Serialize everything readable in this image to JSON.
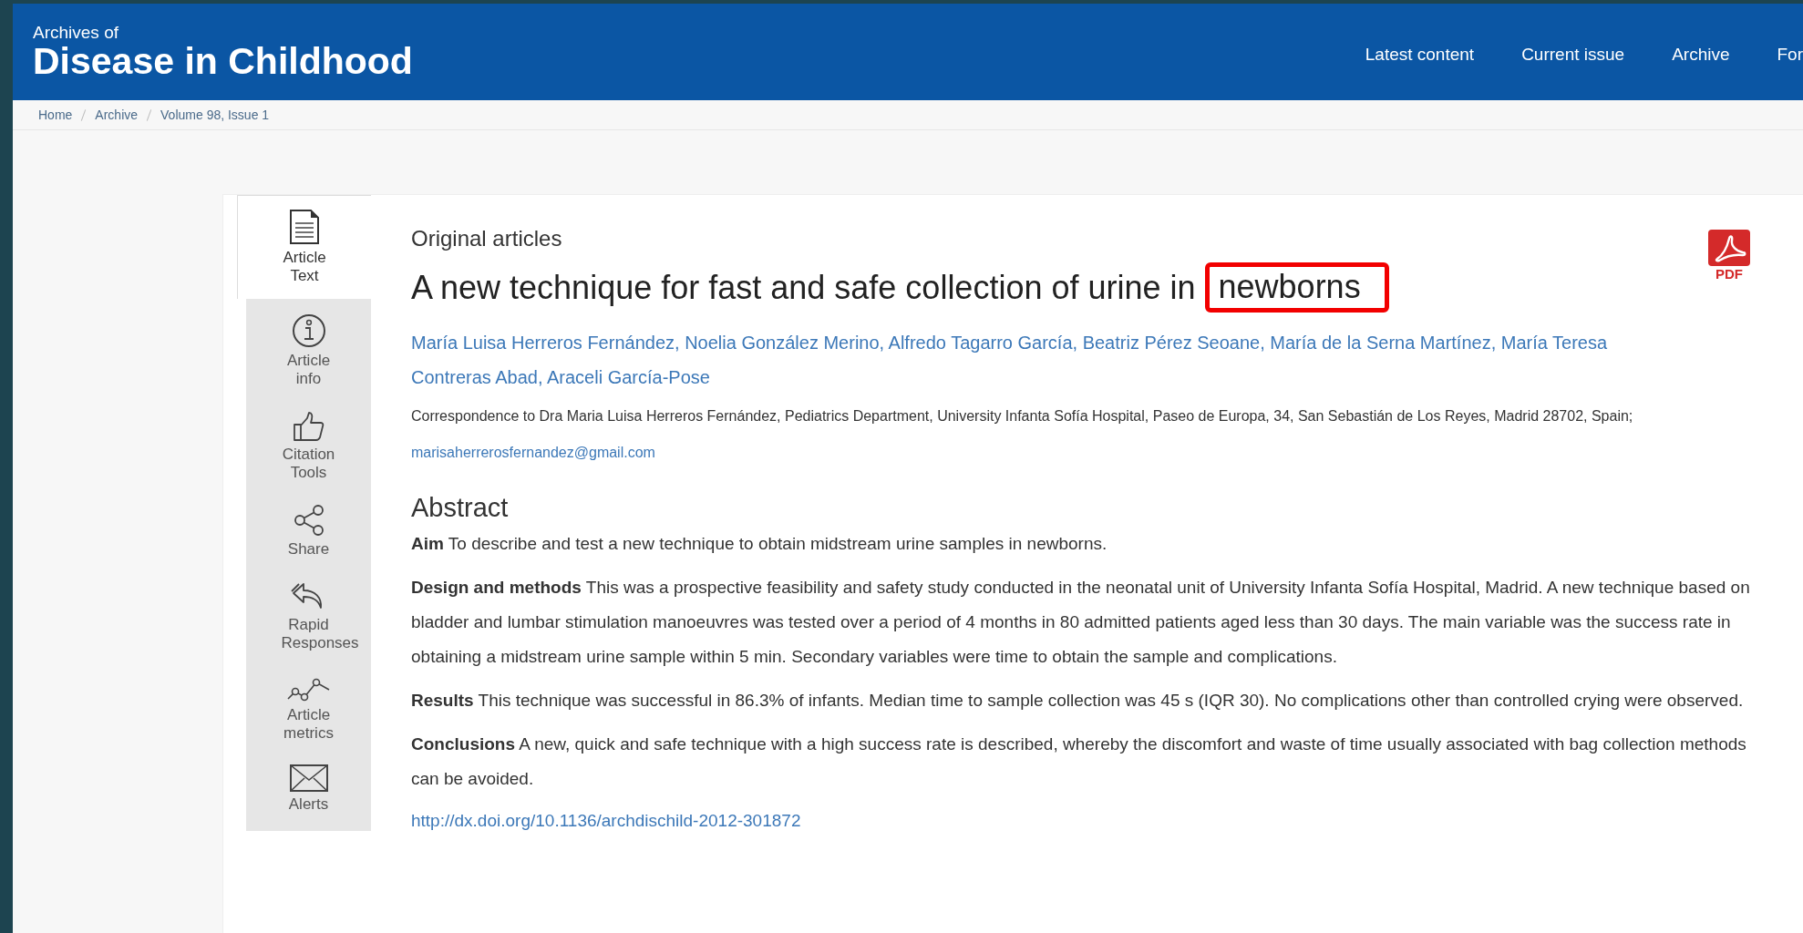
{
  "journal": {
    "prefix": "Archives of",
    "name": "Disease in Childhood"
  },
  "nav": [
    "Latest content",
    "Current issue",
    "Archive",
    "For"
  ],
  "breadcrumb": [
    "Home",
    "Archive",
    "Volume 98, Issue 1"
  ],
  "tabs": [
    {
      "label": "Article Text",
      "kind": "document",
      "selected": true
    },
    {
      "label": "Article info",
      "kind": "info",
      "selected": false
    },
    {
      "label": "Citation Tools",
      "kind": "thumb",
      "selected": false
    },
    {
      "label": "Share",
      "kind": "share",
      "selected": false
    },
    {
      "label": "Rapid Responses",
      "kind": "reply",
      "selected": false
    },
    {
      "label": "Article metrics",
      "kind": "metrics",
      "selected": false
    },
    {
      "label": "Alerts",
      "kind": "mail",
      "selected": false
    }
  ],
  "article": {
    "section": "Original articles",
    "title": "A new technique for fast and safe collection of urine in",
    "highlighted": "newborns",
    "pdf_label": "PDF",
    "authors": "María Luisa Herreros Fernández, Noelia González Merino, Alfredo Tagarro García, Beatriz Pérez Seoane, María de la Serna Martínez, María Teresa Contreras Abad, Araceli García-Pose",
    "correspondence": "Correspondence to Dra Maria Luisa Herreros Fernández, Pediatrics Department, University Infanta Sofía Hospital, Paseo de Europa, 34, San Sebastián de Los Reyes, Madrid 28702, Spain;",
    "email": "marisaherrerosfernandez@gmail.com",
    "abstract_heading": "Abstract",
    "abstract": [
      "**Aim** To describe and test a new technique to obtain midstream urine samples in newborns.",
      "**Design and methods** This was a prospective feasibility and safety study conducted in the neonatal unit of University Infanta Sofía Hospital, Madrid. A new technique based on bladder and lumbar stimulation manoeuvres was tested over a period of 4 months in 80 admitted patients aged less than 30 days. The main variable was the success rate in obtaining a midstream urine sample within 5 min. Secondary variables were time to obtain the sample and complications.",
      "**Results** This technique was successful in 86.3% of infants. Median time to sample collection was 45 s (IQR 30). No complications other than controlled crying were observed.",
      "**Conclusions** A new, quick and safe technique with a high success rate is described, whereby the discomfort and waste of time usually associated with bag collection methods can be avoided."
    ],
    "doi": "http://dx.doi.org/10.1136/archdischild-2012-301872"
  }
}
